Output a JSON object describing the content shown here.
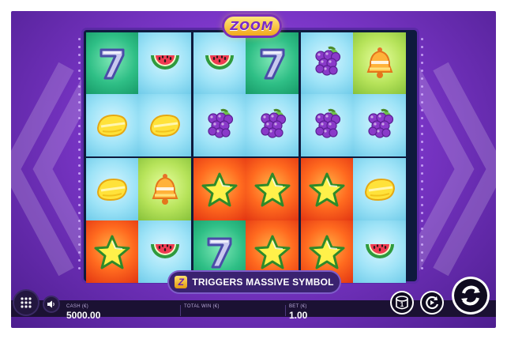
{
  "game": {
    "logo_text": "ZOOM",
    "banner_text": "TRIGGERS MASSIVE SYMBOL",
    "banner_badge": "Z"
  },
  "reels": [
    [
      "seven",
      "watermelon",
      "watermelon",
      "seven",
      "grapes",
      "bell"
    ],
    [
      "lemon",
      "lemon",
      "grapes",
      "grapes",
      "grapes",
      "grapes"
    ],
    [
      "lemon",
      "bell",
      "star",
      "star",
      "star",
      "lemon"
    ],
    [
      "star",
      "watermelon",
      "seven",
      "star",
      "star",
      "watermelon"
    ]
  ],
  "cell_colors": [
    [
      "green",
      "blue",
      "blue",
      "green",
      "blue",
      "lime"
    ],
    [
      "blue",
      "blue",
      "blue",
      "blue",
      "blue",
      "blue"
    ],
    [
      "blue",
      "lime",
      "red",
      "red",
      "red",
      "blue"
    ],
    [
      "red",
      "blue",
      "green",
      "red",
      "red",
      "blue"
    ]
  ],
  "bottom_bar": {
    "cash_label": "CASH (€)",
    "cash_value": "5000.00",
    "total_win_label": "TOTAL WIN (€)",
    "total_win_value": "",
    "bet_label": "BET (€)",
    "bet_value": "1.00"
  },
  "controls": {
    "menu_icon": "grid-icon",
    "sound_icon": "speaker-icon",
    "bet_icon": "coin-stack-icon",
    "autoplay_icon": "autoplay-icon",
    "spin_icon": "spin-icon"
  }
}
